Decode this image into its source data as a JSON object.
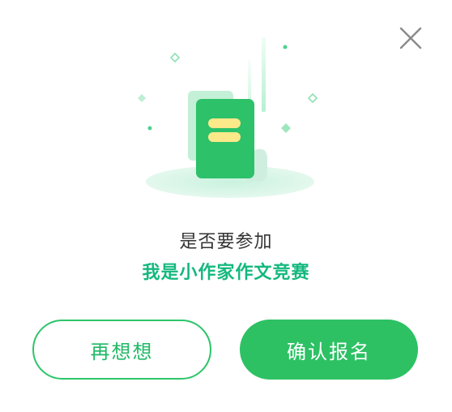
{
  "dialog": {
    "close_icon": "close-icon",
    "prompt": "是否要参加",
    "contest_name": "我是小作家作文竞赛",
    "secondary_button": "再想想",
    "primary_button": "确认报名",
    "colors": {
      "accent_green": "#2dc164",
      "contest_text": "#14b87f",
      "prompt_text": "#333333"
    }
  }
}
